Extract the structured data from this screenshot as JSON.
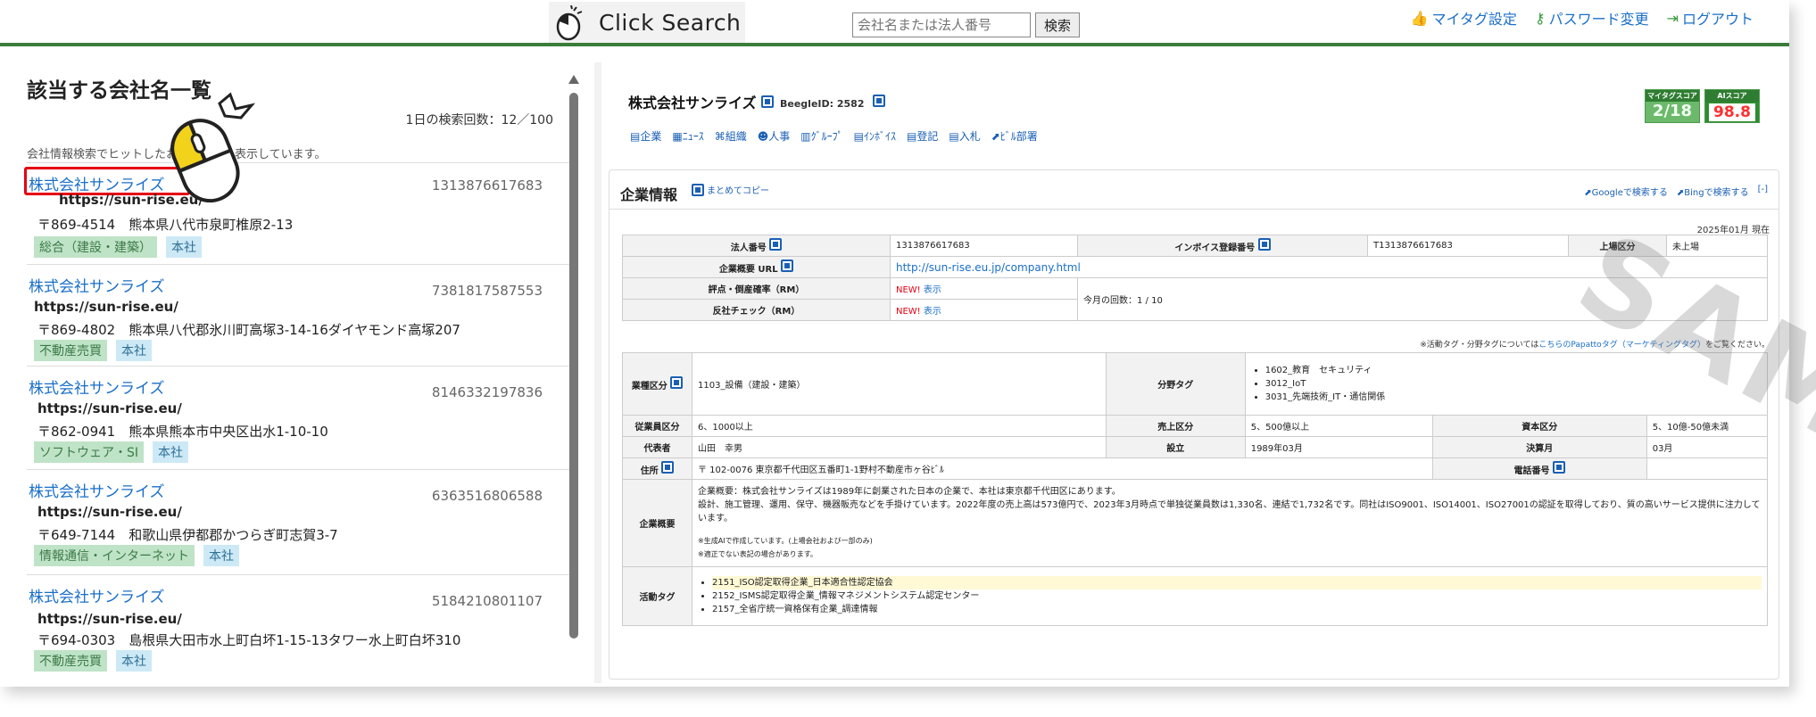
{
  "header": {
    "app_title": "Click Search",
    "search_placeholder": "会社名または法人番号",
    "search_button": "検索",
    "links": [
      {
        "label": "マイタグ設定",
        "icon": "thumbs-up-icon"
      },
      {
        "label": "パスワード変更",
        "icon": "key-icon"
      },
      {
        "label": "ログアウト",
        "icon": "logout-icon"
      }
    ]
  },
  "left": {
    "title": "該当する会社名一覧",
    "count": "1日の検索回数：12／100",
    "info": "会社情報検索でヒットしたお",
    "info2": "表示しています。",
    "results": [
      {
        "name": "株式会社サンライズ",
        "number": "1313876617683",
        "url": "https://sun-rise.eu/",
        "address": "〒869-4514　熊本県八代市泉町椎原2-13",
        "industry": "総合（建設・建築）",
        "type": "本社"
      },
      {
        "name": "株式会社サンライズ",
        "number": "7381817587553",
        "url": "https://sun-rise.eu/",
        "address": "〒869-4802　熊本県八代郡氷川町高塚3-14-16ダイヤモンド高塚207",
        "industry": "不動産売買",
        "type": "本社"
      },
      {
        "name": "株式会社サンライズ",
        "number": "8146332197836",
        "url": "https://sun-rise.eu/",
        "address": "〒862-0941　熊本県熊本市中央区出水1-10-10",
        "industry": "ソフトウェア・SI",
        "type": "本社"
      },
      {
        "name": "株式会社サンライズ",
        "number": "6363516806588",
        "url": "https://sun-rise.eu/",
        "address": "〒649-7144　和歌山県伊都郡かつらぎ町志賀3-7",
        "industry": "情報通信・インターネット",
        "type": "本社"
      },
      {
        "name": "株式会社サンライズ",
        "number": "5184210801107",
        "url": "https://sun-rise.eu/",
        "address": "〒694-0303　島根県大田市水上町白坏1-15-13タワー水上町白坏310",
        "industry": "不動産売買",
        "type": "本社"
      }
    ]
  },
  "right": {
    "company": "株式会社サンライズ",
    "beegle_id": "BeegleID: 2582",
    "tabs": [
      "企業",
      "ﾆｭｰｽ",
      "組織",
      "人事",
      "ｸﾞﾙｰﾌﾟ",
      "ｲﾝﾎﾞｲｽ",
      "登記",
      "入札",
      "ﾋﾞﾙ",
      "部署"
    ],
    "scores": {
      "my_label": "マイタグスコア",
      "my_value": "2/18",
      "ai_label": "AIスコア",
      "ai_value": "98.8"
    },
    "card_title": "企業情報",
    "copy_all": "まとめてコピー",
    "google": "Googleで検索する",
    "bing": "Bingで検索する",
    "collapse": "[-]",
    "as_of": "2025年01月 現在",
    "watermark": "SAMPLE",
    "t1": {
      "corp_no_label": "法人番号",
      "corp_no": "1313876617683",
      "invoice_label": "インボイス登録番号",
      "invoice": "T1313876617683",
      "listing_label": "上場区分",
      "listing": "未上場",
      "url_label": "企業概要 URL",
      "url": "http://sun-rise.eu.jp/company.html",
      "rating_label": "評点・倒産確率（RM）",
      "rating_new": "NEW!",
      "rating_show": "表示",
      "anti_label": "反社チェック（RM）",
      "anti_new": "NEW!",
      "anti_show": "表示",
      "monthly": "今月の回数：1 / 10"
    },
    "note_prefix": "※活動タグ・分野タグについては",
    "note_link": "こちらのPapattoタグ（マーケティングタグ）",
    "note_suffix": "をご覧ください。",
    "t2": {
      "industry_label": "業種区分",
      "industry": "1103_設備（建設・建築）",
      "field_label": "分野タグ",
      "fields": [
        "1602_教育　セキュリティ",
        "3012_IoT",
        "3031_先端技術_IT・通信関係"
      ],
      "emp_label": "従業員区分",
      "emp": "6、1000以上",
      "sales_label": "売上区分",
      "sales": "5、500億以上",
      "capital_label": "資本区分",
      "capital": "5、10億-50億未満",
      "rep_label": "代表者",
      "rep": "山田　幸男",
      "est_label": "設立",
      "est": "1989年03月",
      "fiscal_label": "決算月",
      "fiscal": "03月",
      "addr_label": "住所",
      "addr": "〒 102-0076 東京都千代田区五番町1-1野村不動産市ヶ谷ﾋﾞﾙ",
      "tel_label": "電話番号",
      "tel": "",
      "summary_label": "企業概要",
      "summary1": "企業概要：株式会社サンライズは1989年に創業された日本の企業で、本社は東京都千代田区にあります。",
      "summary2": "設計、施工管理、運用、保守、機器販売などを手掛けています。2022年度の売上高は573億円で、2023年3月時点で単独従業員数は1,330名、連結で1,732名です。同社はISO9001、ISO14001、ISO27001の認証を取得しており、質の高いサービス提供に注力しています。",
      "summary3": "※生成AIで作成しています。(上場会社および一部のみ)",
      "summary4": "※適正でない表記の場合があります。",
      "activity_label": "活動タグ",
      "activities": [
        "2151_ISO認定取得企業_日本適合性認定協会",
        "2152_ISMS認定取得企業_情報マネジメントシステム認定センター",
        "2157_全省庁統一資格保有企業_調達情報"
      ]
    }
  },
  "colors": {
    "accent_green": "#3a7d3a",
    "link_blue": "#1a6fc9",
    "highlight_red": "#e60012"
  }
}
